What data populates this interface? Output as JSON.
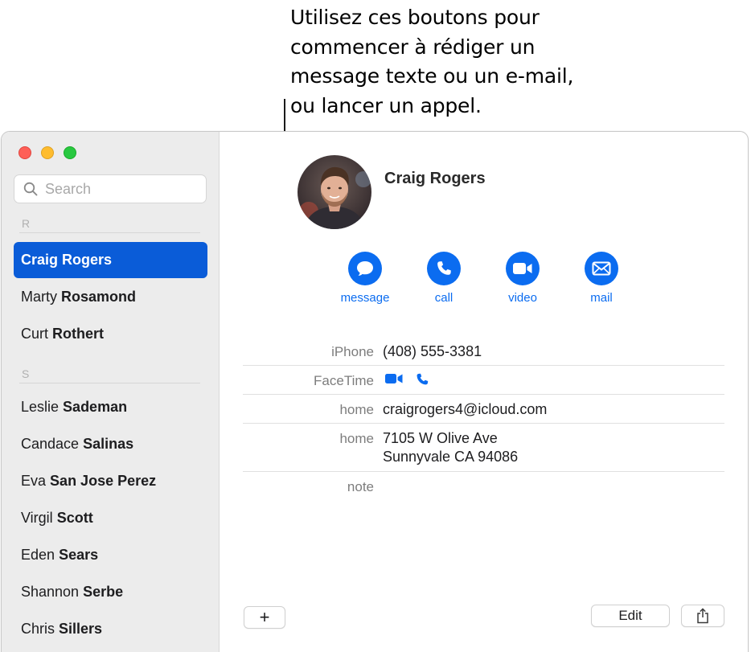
{
  "callout": {
    "lines": [
      "Utilisez ces boutons pour",
      "commencer à rédiger un",
      "message texte ou un e-mail,",
      "ou lancer un appel."
    ]
  },
  "sidebar": {
    "search_placeholder": "Search",
    "sections": [
      {
        "letter": "R"
      },
      {
        "letter": "S"
      }
    ],
    "contacts": [
      {
        "first": "Craig",
        "last": "Rogers"
      },
      {
        "first": "Marty",
        "last": "Rosamond"
      },
      {
        "first": "Curt",
        "last": "Rothert"
      },
      {
        "first": "Leslie",
        "last": "Sademan"
      },
      {
        "first": "Candace",
        "last": "Salinas"
      },
      {
        "first": "Eva",
        "last": "San Jose Perez"
      },
      {
        "first": "Virgil",
        "last": "Scott"
      },
      {
        "first": "Eden",
        "last": "Sears"
      },
      {
        "first": "Shannon",
        "last": "Serbe"
      },
      {
        "first": "Chris",
        "last": "Sillers"
      }
    ]
  },
  "detail": {
    "name": "Craig Rogers",
    "actions": [
      {
        "label": "message",
        "icon": "message-bubble-icon"
      },
      {
        "label": "call",
        "icon": "phone-icon"
      },
      {
        "label": "video",
        "icon": "video-camera-icon"
      },
      {
        "label": "mail",
        "icon": "envelope-icon"
      }
    ],
    "fields": {
      "iphone_label": "iPhone",
      "iphone_value": "(408) 555-3381",
      "facetime_label": "FaceTime",
      "email_label": "home",
      "email_value": "craigrogers4@icloud.com",
      "address_label": "home",
      "address_line1": "7105 W Olive Ave",
      "address_line2": "Sunnyvale CA 94086",
      "note_label": "note"
    },
    "buttons": {
      "add": "+",
      "edit": "Edit"
    }
  },
  "colors": {
    "accent": "#0b6cf0",
    "selection": "#0a5cd8",
    "sidebar_bg": "#ececec"
  }
}
